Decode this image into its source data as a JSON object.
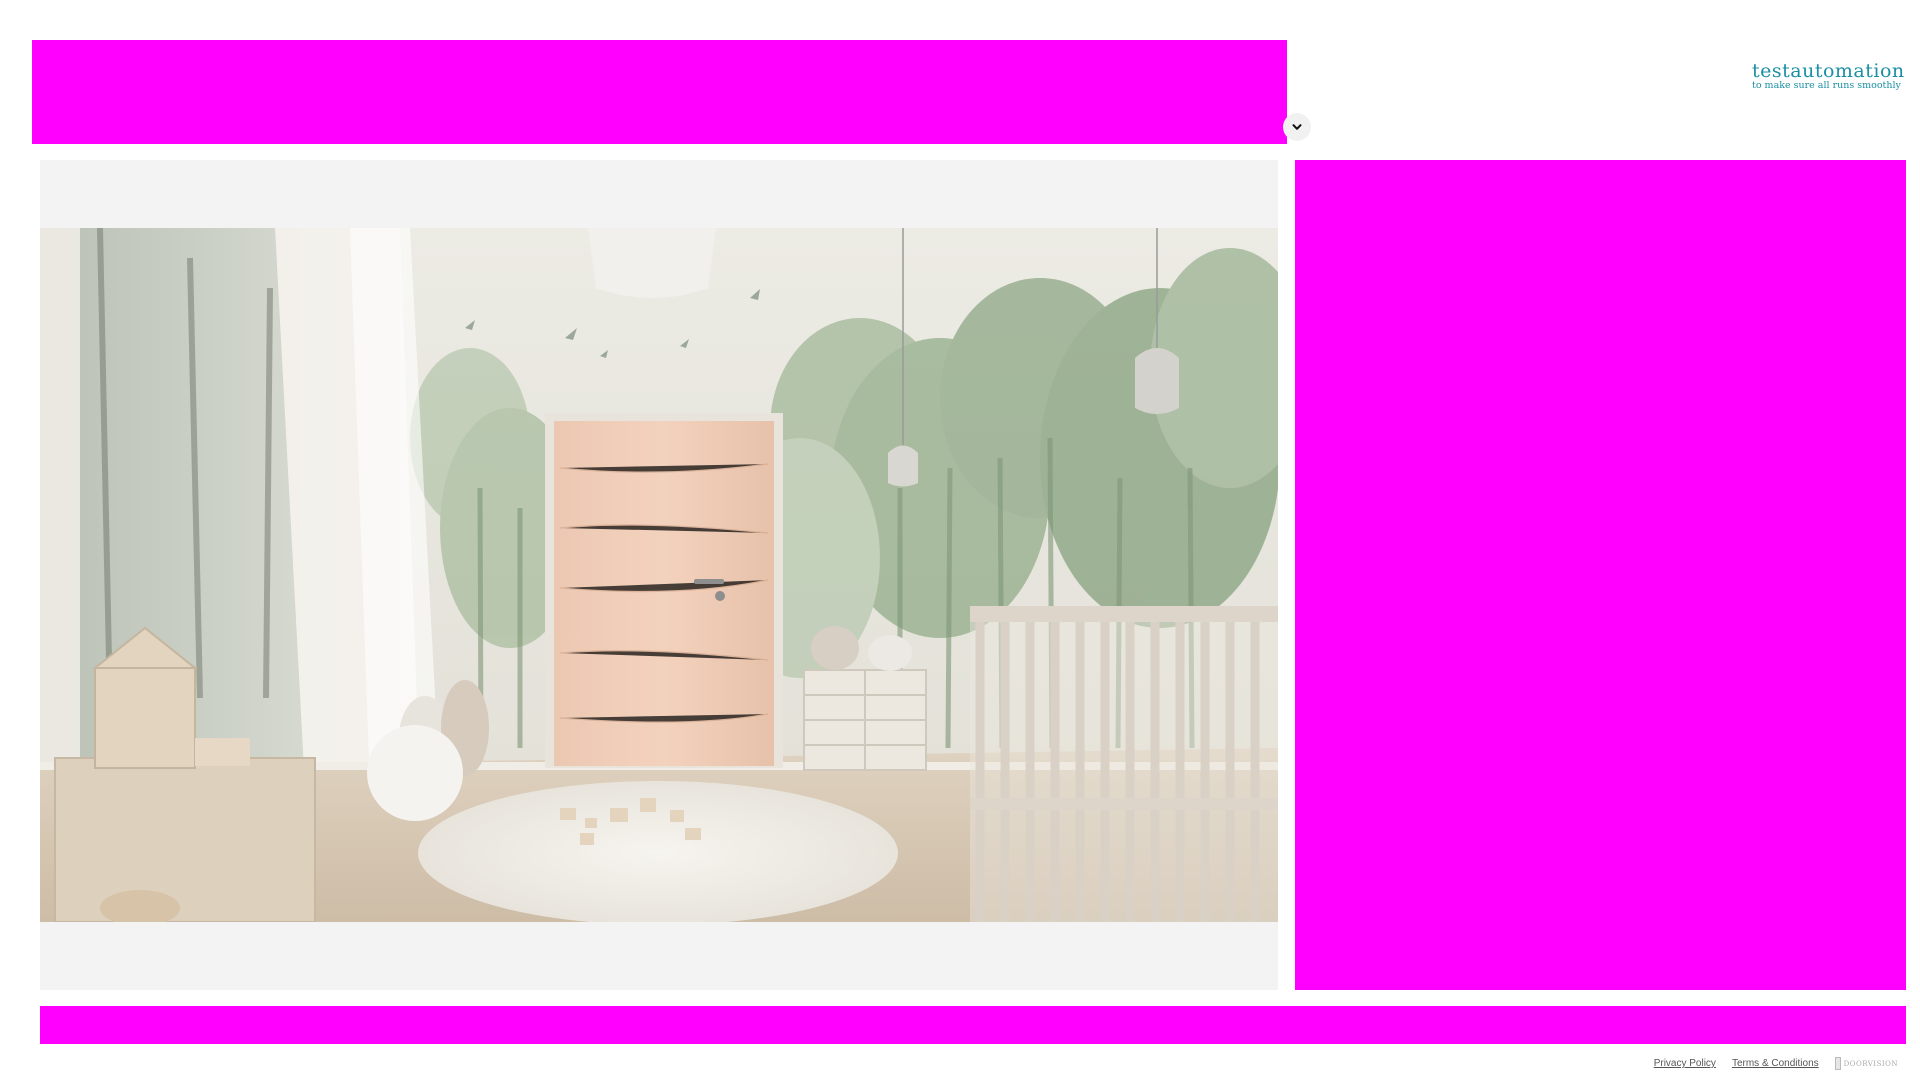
{
  "logo": {
    "title": "testautomation",
    "tagline": "to make sure all runs smoothly"
  },
  "toggle": {
    "icon": "chevron-down-icon"
  },
  "preview": {
    "scene": "nursery room with wooden door"
  },
  "footer": {
    "privacy_label": "Privacy Policy",
    "terms_label": "Terms & Conditions",
    "brand_label": "DOORVISION"
  },
  "colors": {
    "mask": "#ff00ff",
    "logo": "#1b8fa3",
    "preview_bg": "#f3f3f3"
  }
}
